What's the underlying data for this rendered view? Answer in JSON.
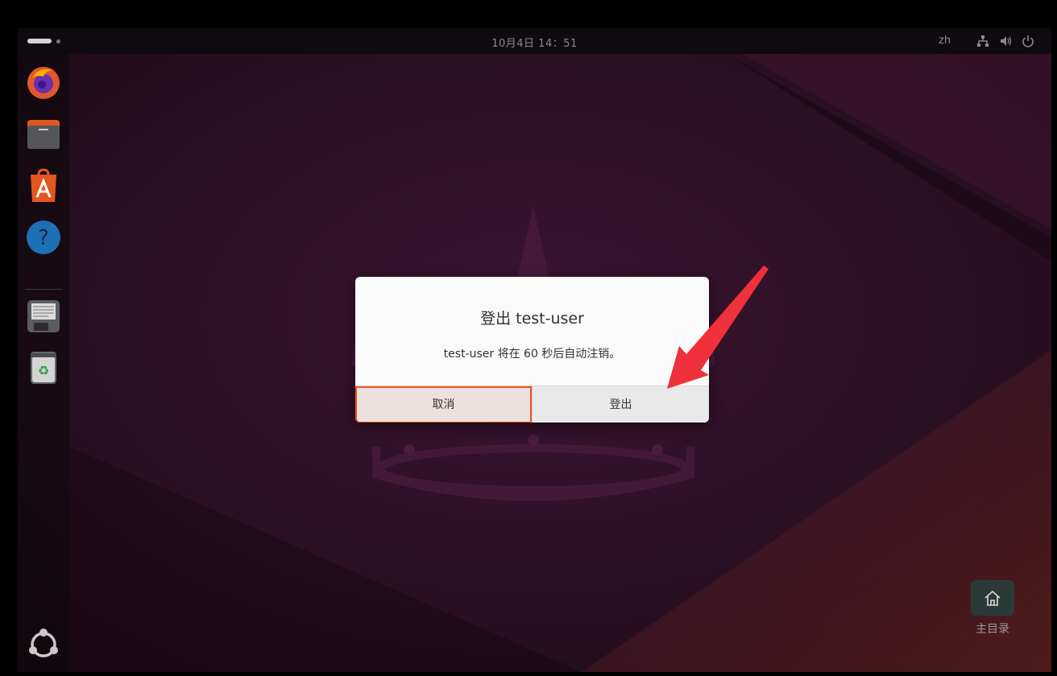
{
  "topbar": {
    "clock": "10月4日  14：51",
    "language": "zh"
  },
  "dock": {
    "items": [
      "firefox-icon",
      "files-icon",
      "app-center-icon",
      "help-icon",
      "text-editor-icon",
      "trash-icon"
    ],
    "show_apps": "ubuntu-logo-icon"
  },
  "desktop": {
    "home_label": "主目录"
  },
  "dialog": {
    "title": "登出 test-user",
    "message": "test-user 将在 60 秒后自动注销。",
    "cancel_label": "取消",
    "logout_label": "登出"
  },
  "colors": {
    "accent": "#e95420",
    "annotation_arrow": "#f0303a"
  }
}
